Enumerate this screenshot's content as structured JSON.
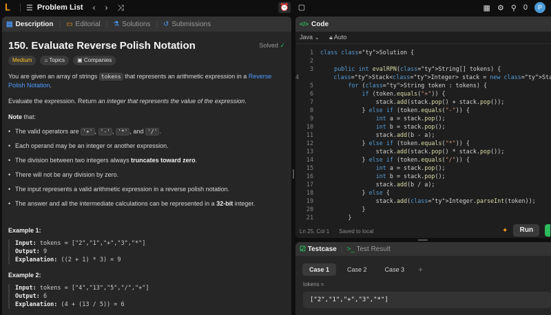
{
  "topbar": {
    "problem_list_label": "Problem List",
    "prev_icon": "chevron-left-icon",
    "next_icon": "chevron-right-icon",
    "shuffle_icon": "shuffle-icon",
    "coin_count": "0",
    "avatar_letter": "P"
  },
  "description": {
    "tabs": [
      "Description",
      "Editorial",
      "Solutions",
      "Submissions"
    ],
    "title": "150. Evaluate Reverse Polish Notation",
    "status": "Solved",
    "chips": [
      "Medium",
      "Topics",
      "Companies"
    ],
    "intro_pre": "You are given an array of strings ",
    "intro_code": "tokens",
    "intro_mid": " that represents an arithmetic expression in a ",
    "intro_link": "Reverse Polish Notation",
    "intro_post": ".",
    "evaluate_pre": "Evaluate the expression. Return ",
    "evaluate_em": "an integer that represents the value of the expression",
    "evaluate_post": ".",
    "note_label": "Note",
    "note_colon": " that:",
    "notes": {
      "ops_pre": "The valid operators are ",
      "op1": "'+'",
      "op2": "'-'",
      "op3": "'*'",
      "op_and": ", and ",
      "op4": "'/'",
      "ops_post": ".",
      "n2": "Each operand may be an integer or another expression.",
      "n3_pre": "The division between two integers always ",
      "n3_bold": "truncates toward zero",
      "n3_post": ".",
      "n4": "There will not be any division by zero.",
      "n5": "The input represents a valid arithmetic expression in a reverse polish notation.",
      "n6_pre": "The answer and all the intermediate calculations can be represented in a ",
      "n6_bold": "32-bit",
      "n6_post": " integer."
    },
    "examples": [
      {
        "title": "Example 1:",
        "input_label": "Input:",
        "input": " tokens = [\"2\",\"1\",\"+\",\"3\",\"*\"]",
        "output_label": "Output:",
        "output": " 9",
        "explanation_label": "Explanation:",
        "explanation": " ((2 + 1) * 3) = 9"
      },
      {
        "title": "Example 2:",
        "input_label": "Input:",
        "input": " tokens = [\"4\",\"13\",\"5\",\"/\",\"+\"]",
        "output_label": "Output:",
        "output": " 6",
        "explanation_label": "Explanation:",
        "explanation": " (4 + (13 / 5)) = 6"
      }
    ]
  },
  "code": {
    "header": "Code",
    "language": "Java",
    "mode": "Auto",
    "lines": [
      "class Solution {",
      "",
      "    public int evalRPN(String[] tokens) {",
      "        Stack<Integer> stack = new Stack<>();",
      "        for (String token : tokens) {",
      "            if (token.equals(\"+\")) {",
      "                stack.add(stack.pop() + stack.pop());",
      "            } else if (token.equals(\"-\")) {",
      "                int a = stack.pop();",
      "                int b = stack.pop();",
      "                stack.add(b - a);",
      "            } else if (token.equals(\"*\")) {",
      "                stack.add(stack.pop() * stack.pop());",
      "            } else if (token.equals(\"/\")) {",
      "                int a = stack.pop();",
      "                int b = stack.pop();",
      "                stack.add(b / a);",
      "            } else {",
      "                stack.add(Integer.parseInt(token));",
      "            }",
      "        }"
    ],
    "cursor": "Ln 25, Col 1",
    "save_status": "Saved to local",
    "run_label": "Run"
  },
  "testcase": {
    "tab_label": "Testcase",
    "result_tab_label": "Test Result",
    "cases": [
      "Case 1",
      "Case 2",
      "Case 3"
    ],
    "var_label": "tokens =",
    "value": "[\"2\",\"1\",\"+\",\"3\",\"*\"]"
  },
  "colors": {
    "accent": "#ffa116",
    "success": "#2cbb5d",
    "link": "#4d9bff",
    "medium": "#ffc01e"
  }
}
